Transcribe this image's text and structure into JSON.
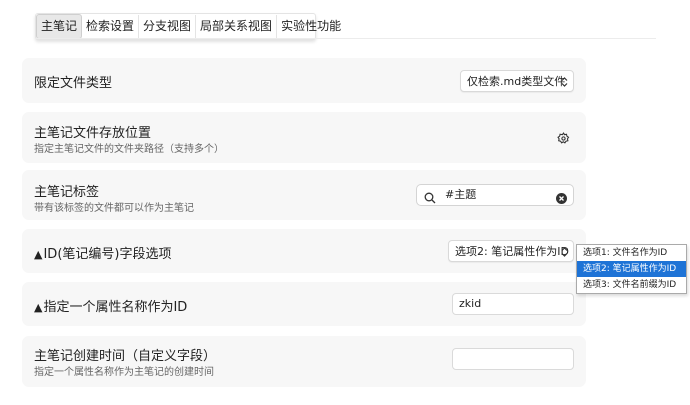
{
  "tabs": [
    {
      "label": "主笔记",
      "active": true
    },
    {
      "label": "检索设置",
      "active": false
    },
    {
      "label": "分支视图",
      "active": false
    },
    {
      "label": "局部关系视图",
      "active": false
    },
    {
      "label": "实验性功能",
      "active": false
    }
  ],
  "settings": {
    "file_type": {
      "title": "限定文件类型",
      "select_value": "仅检索.md类型文件"
    },
    "storage": {
      "title": "主笔记文件存放位置",
      "desc": "指定主笔记文件的文件夹路径（支持多个）"
    },
    "tag": {
      "title": "主笔记标签",
      "desc": "带有该标签的文件都可以作为主笔记",
      "search_value": "#主题"
    },
    "id_field": {
      "warn": "▲",
      "title": "ID(笔记编号)字段选项",
      "select_value": "选项2: 笔记属性作为ID",
      "options": [
        "选项1: 文件名作为ID",
        "选项2: 笔记属性作为ID",
        "选项3: 文件名前缀为ID"
      ],
      "selected_index": 1
    },
    "attr_name": {
      "warn": "▲",
      "title": "指定一个属性名称作为ID",
      "input_value": "zkid"
    },
    "created_time": {
      "title": "主笔记创建时间（自定义字段）",
      "desc": "指定一个属性名称作为主笔记的创建时间",
      "input_value": ""
    }
  },
  "icons": {
    "gear": "gear-icon",
    "search": "search-icon",
    "clear": "clear-icon",
    "chevron": "chevron-updown-icon"
  },
  "colors": {
    "accent": "#1e73d6",
    "card_bg": "#f7f7f7"
  }
}
